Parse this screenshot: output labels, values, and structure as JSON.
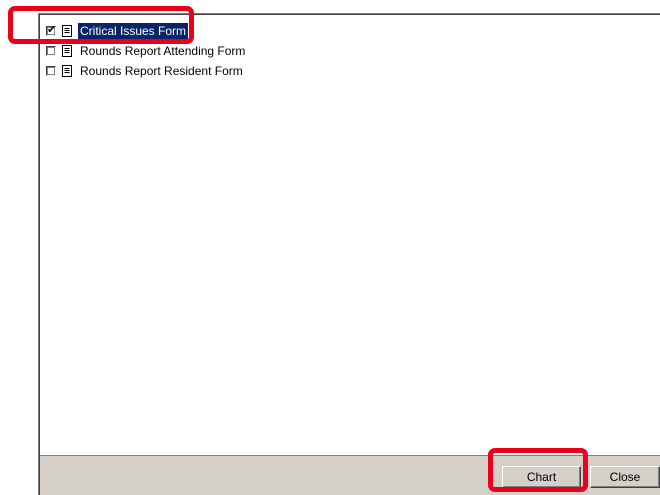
{
  "forms": [
    {
      "label": "Critical Issues Form",
      "checked": true,
      "selected": true
    },
    {
      "label": "Rounds Report Attending Form",
      "checked": false,
      "selected": false
    },
    {
      "label": "Rounds Report Resident Form",
      "checked": false,
      "selected": false
    }
  ],
  "buttons": {
    "chart": "Chart",
    "close": "Close"
  },
  "checkmark": "✔",
  "colors": {
    "selection": "#0a246a",
    "highlight": "#e8001c",
    "face": "#d4d0c8"
  }
}
